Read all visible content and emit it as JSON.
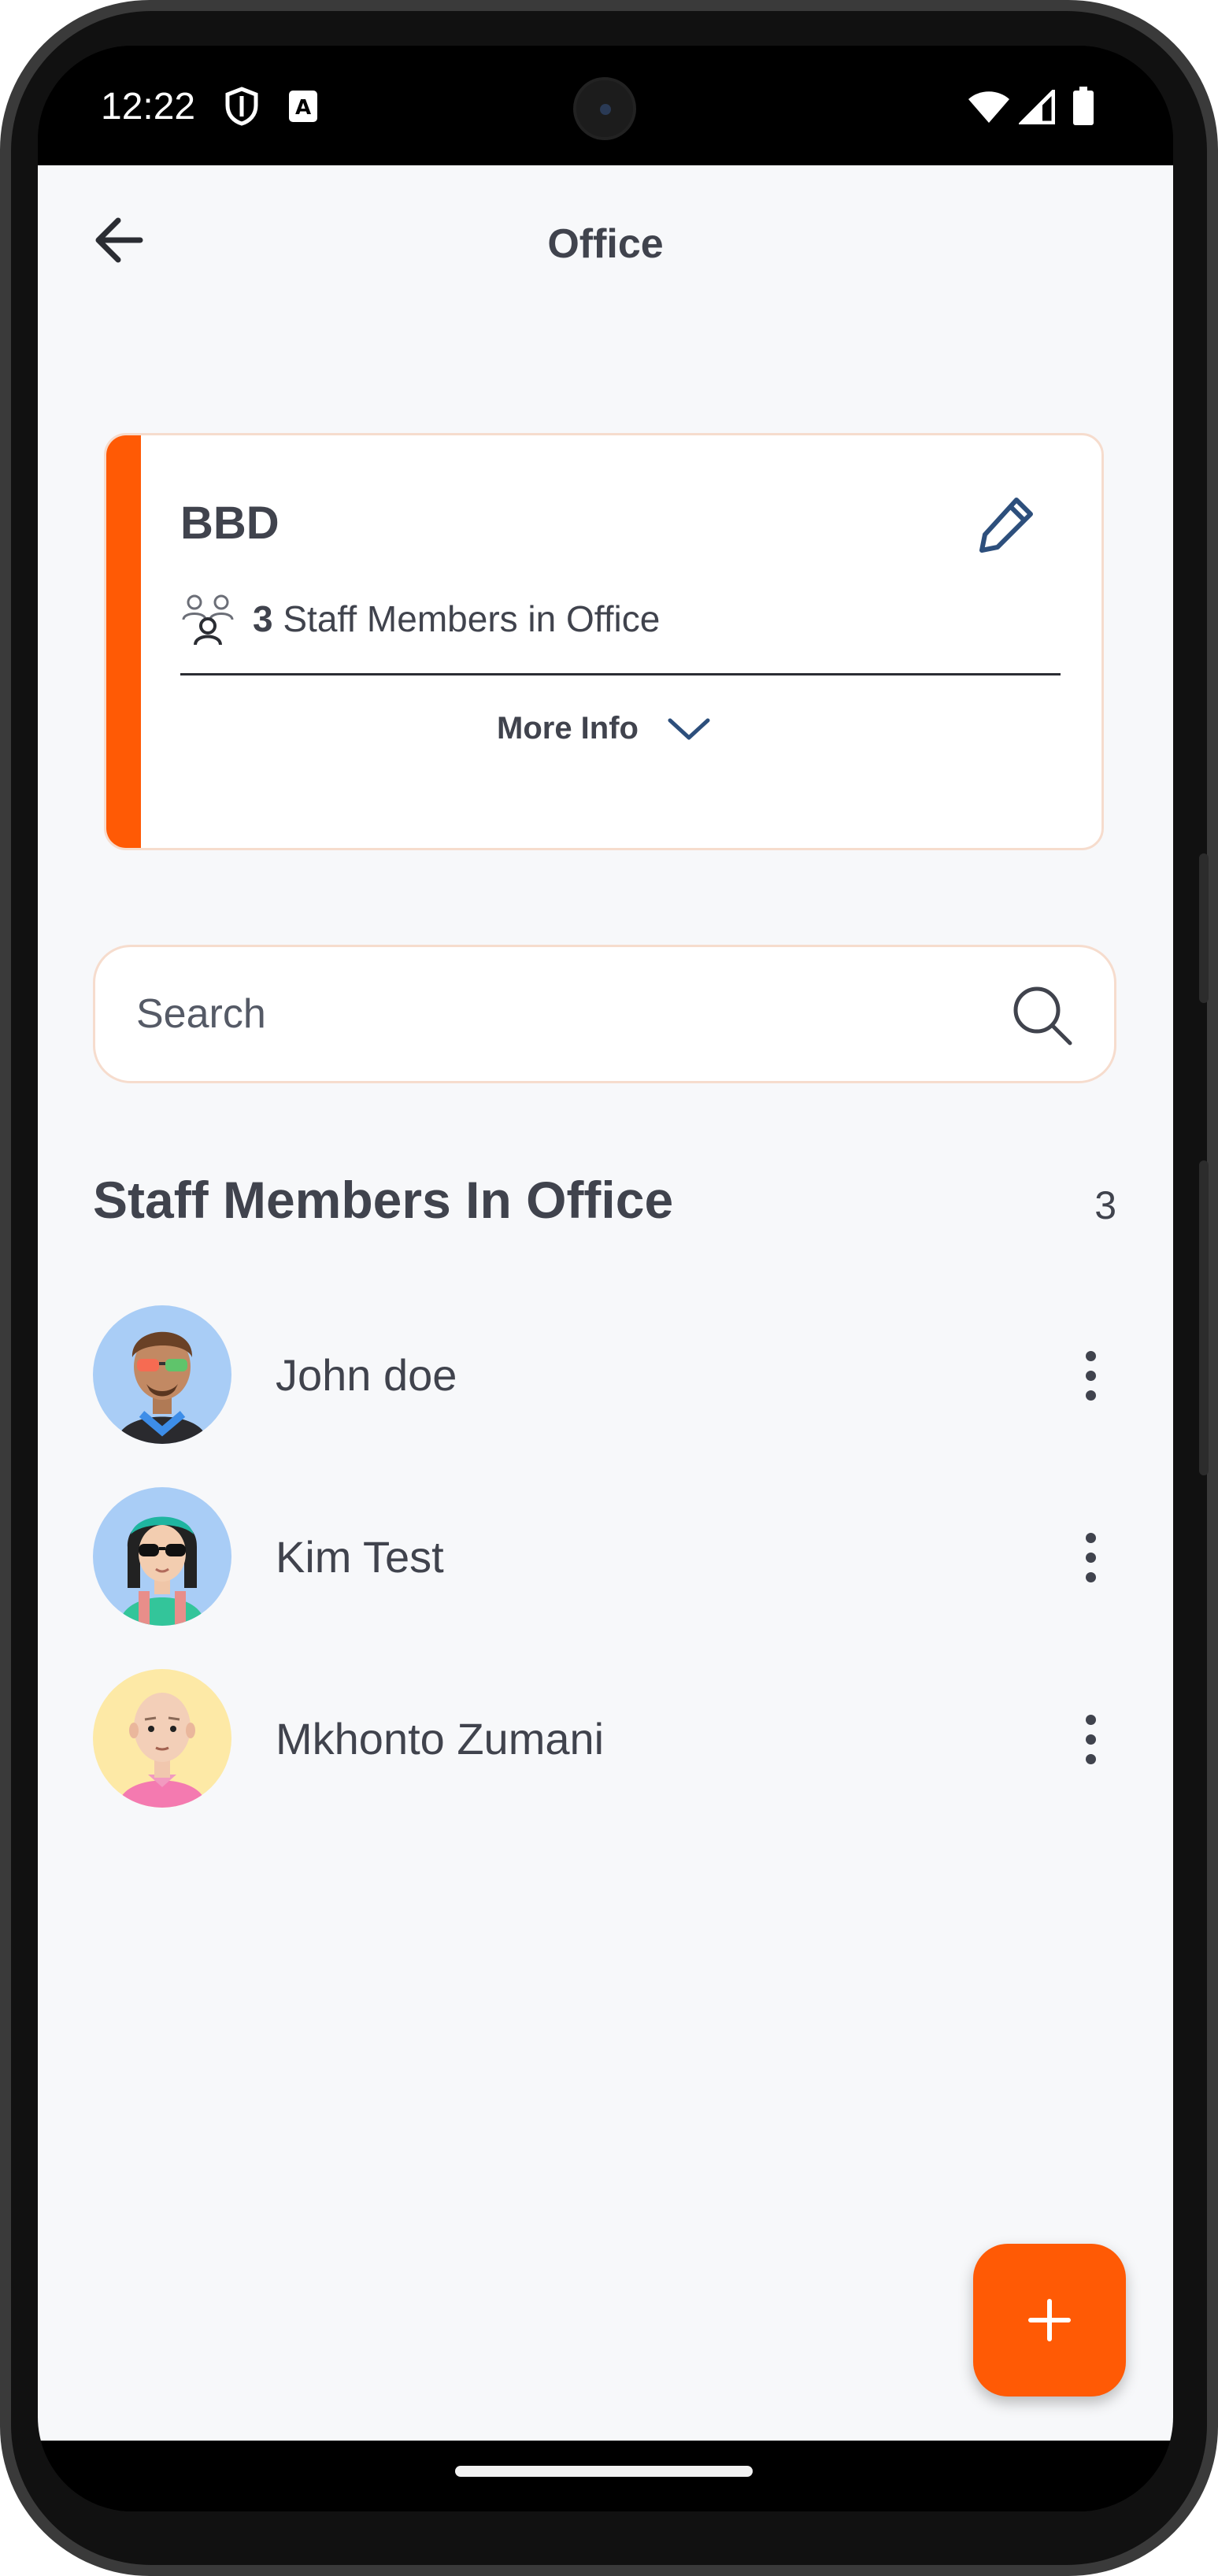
{
  "status_bar": {
    "time": "12:22",
    "icons": [
      "shield-icon",
      "a-notification-icon",
      "wifi-icon",
      "cellular-signal-icon",
      "battery-icon"
    ]
  },
  "header": {
    "title": "Office",
    "back_icon": "arrow-left-icon"
  },
  "office_card": {
    "name": "BBD",
    "staff_count": "3",
    "staff_count_suffix": " Staff Members in Office",
    "more_info_label": "More Info",
    "accent_color": "#ff5a05",
    "edit_icon": "pencil-icon",
    "staff_icon": "people-group-icon",
    "expand_icon": "chevron-down-icon"
  },
  "search": {
    "placeholder": "Search",
    "value": ""
  },
  "staff_section": {
    "title": "Staff Members In Office",
    "count": "3",
    "members": [
      {
        "name": "John doe",
        "avatar": "avatar-man-rainbow-glasses",
        "avatar_bg": "#a9cdf6"
      },
      {
        "name": "Kim Test",
        "avatar": "avatar-woman-sunglasses",
        "avatar_bg": "#a9cdf6"
      },
      {
        "name": "Mkhonto Zumani",
        "avatar": "avatar-bald-man-pink-shirt",
        "avatar_bg": "#fde9a6"
      }
    ]
  },
  "fab": {
    "icon": "plus-icon",
    "color": "#ff5a05"
  }
}
